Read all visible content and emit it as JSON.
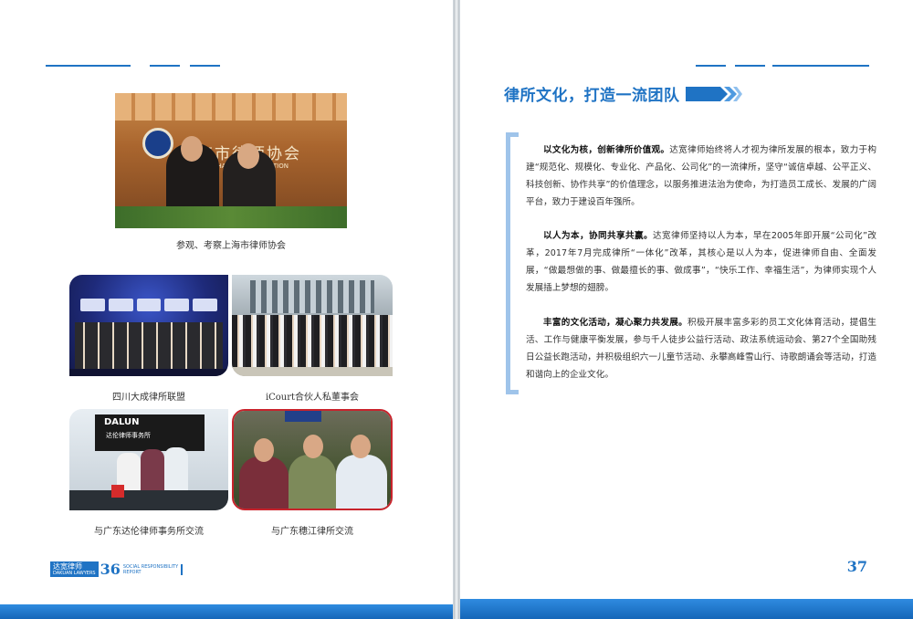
{
  "left_page": {
    "page_number": "36",
    "logo": {
      "name": "达宽律师",
      "sub": "DAKUAN LAWYERS"
    },
    "report_tag": {
      "line1": "SOCIAL RESPONSIBILITY",
      "line2": "REPORT"
    },
    "captions": {
      "photo1": "参观、考察上海市律师协会",
      "photo2": "四川大成律所联盟",
      "photo3": "iCourt合伙人私董事会",
      "photo4": "与广东达伦律师事务所交流",
      "photo5": "与广东穗江律所交流"
    },
    "photo_signs": {
      "photo1": "海市律师协会",
      "photo1_en": "ANGHAI BAR ASSOCIATION",
      "photo4": "DALUN",
      "photo4_sub": "达伦律师事务所"
    }
  },
  "right_page": {
    "page_number": "37",
    "title": "律所文化，打造一流团队",
    "paragraphs": [
      {
        "lead": "以文化为核，创新律所价值观。",
        "body": "达宽律师始终将人才视为律所发展的根本，致力于构建“规范化、规模化、专业化、产品化、公司化”的一流律所，坚守“诚信卓越、公平正义、科技创新、协作共享”的价值理念，以服务推进法治为使命，为打造员工成长、发展的广阔平台，致力于建设百年强所。"
      },
      {
        "lead": "以人为本，协同共享共赢。",
        "body": "达宽律师坚持以人为本，早在2005年即开展“公司化”改革，2017年7月完成律所“一体化”改革，其核心是以人为本，促进律师自由、全面发展，“做最想做的事、做最擅长的事、做成事”，“快乐工作、幸福生活”，为律师实现个人发展插上梦想的翅膀。"
      },
      {
        "lead": "丰富的文化活动，凝心聚力共发展。",
        "body": "积极开展丰富多彩的员工文化体育活动，提倡生活、工作与健康平衡发展，参与千人徒步公益行活动、政法系统运动会、第27个全国助残日公益长跑活动，并积极组织六一儿童节活动、永攀高峰雪山行、诗歌朗诵会等活动，打造和谐向上的企业文化。"
      }
    ]
  },
  "colors": {
    "accent": "#1f73c4",
    "bracket": "#9fc4ea"
  }
}
